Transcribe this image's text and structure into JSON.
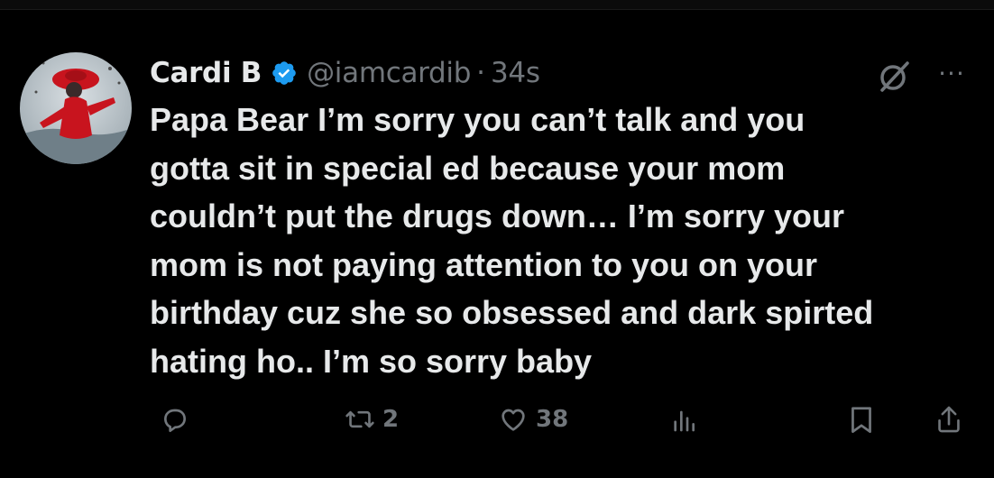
{
  "tweet": {
    "author_name": "Cardi B",
    "handle": "@iamcardib",
    "separator": "·",
    "timestamp": "34s",
    "text": "Papa Bear I’m sorry you can’t talk and you\ngotta sit in special ed because your mom\ncouldn’t put the drugs down… I’m sorry your\nmom is not paying attention to you on your\nbirthday cuz she so obsessed and dark spirted\nhating ho.. I’m so sorry baby",
    "more_label": "···"
  },
  "actions": {
    "reply_count": "",
    "retweet_count": "2",
    "like_count": "38"
  },
  "icons": {
    "verified": "verified-badge-icon",
    "grok": "grok-icon",
    "more": "more-icon",
    "reply": "reply-icon",
    "retweet": "retweet-icon",
    "like": "heart-icon",
    "views": "analytics-icon",
    "bookmark": "bookmark-icon",
    "share": "share-icon"
  },
  "colors": {
    "background": "#000000",
    "text_primary": "#e7e9ea",
    "text_secondary": "#71767b",
    "verified_blue": "#1d9bf0",
    "avatar_red": "#c8141e"
  }
}
